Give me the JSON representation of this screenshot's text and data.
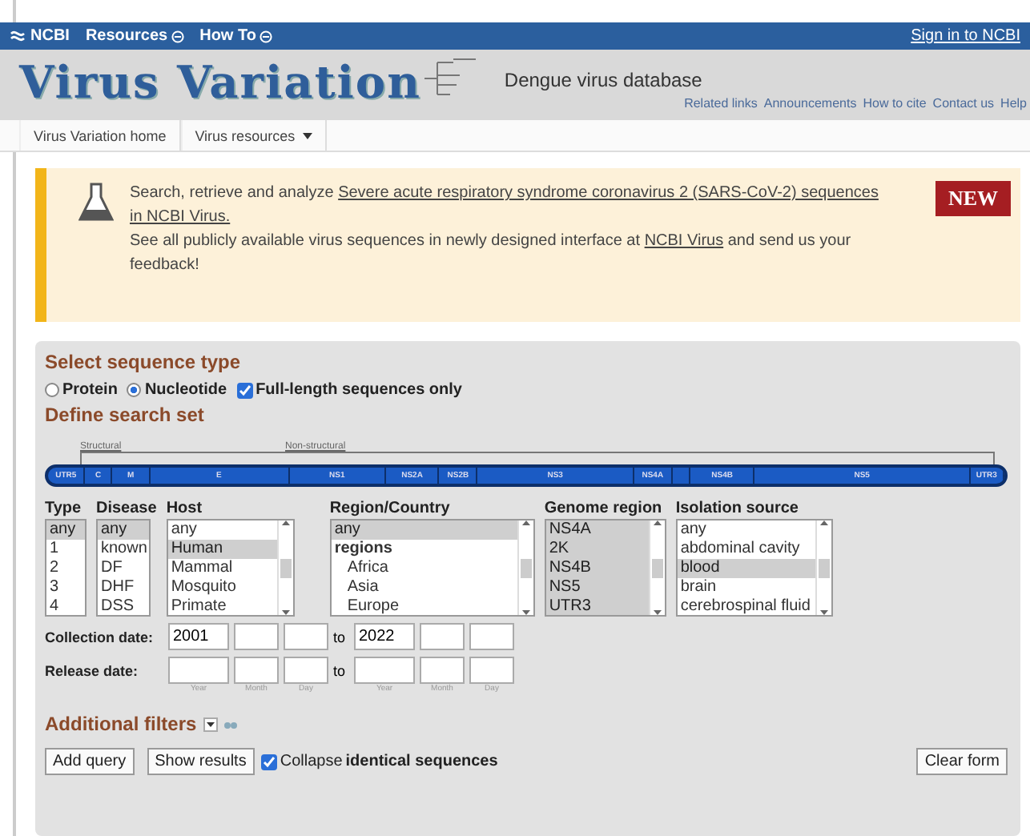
{
  "topbar": {
    "brand": "NCBI",
    "menus": [
      "Resources",
      "How To"
    ],
    "signin": "Sign in to NCBI"
  },
  "header": {
    "logo": "Virus Variation",
    "subtitle": "Dengue virus database",
    "links": [
      "Related links",
      "Announcements",
      "How to cite",
      "Contact us",
      "Help"
    ]
  },
  "nav": [
    {
      "label": "Virus Variation home",
      "dropdown": false
    },
    {
      "label": "Virus resources",
      "dropdown": true
    }
  ],
  "banner": {
    "line1": "Search, retrieve and analyze ",
    "link1": "Severe acute respiratory syndrome coronavirus 2 (SARS-CoV-2) sequences",
    "link1b": "in NCBI Virus.",
    "line2a": "See all publicly available virus sequences in newly designed interface at ",
    "link2": "NCBI Virus",
    "line2b": " and send us your feedback!",
    "badge": "NEW"
  },
  "form": {
    "title": "Select sequence type",
    "seqtype": [
      {
        "label": "Protein",
        "selected": false
      },
      {
        "label": "Nucleotide",
        "selected": true
      }
    ],
    "fulllength": {
      "label": "Full-length sequences only",
      "checked": true
    },
    "searchset": "Define search set",
    "brackets": [
      "Structural",
      "Non-structural"
    ],
    "segments": [
      {
        "kind": "named",
        "label": "UTR5"
      },
      {
        "kind": "named",
        "label": "C"
      },
      {
        "kind": "named",
        "label": "M"
      },
      {
        "kind": "named",
        "label": "E"
      },
      {
        "kind": "named",
        "label": "NS1"
      },
      {
        "kind": "named",
        "label": "NS2A"
      },
      {
        "kind": "named",
        "label": "NS2B"
      },
      {
        "kind": "named",
        "label": "NS3"
      },
      {
        "kind": "named",
        "label": "NS4A"
      },
      {
        "kind": "gap"
      },
      {
        "kind": "named",
        "label": "NS4B"
      },
      {
        "kind": "named",
        "label": "NS5"
      },
      {
        "kind": "named",
        "label": "UTR3"
      }
    ],
    "lists": [
      {
        "title": "Type",
        "scroll": false,
        "options": [
          {
            "label": "any",
            "selected": true
          },
          {
            "label": "1",
            "selected": false
          },
          {
            "label": "2",
            "selected": false
          },
          {
            "label": "3",
            "selected": false
          },
          {
            "label": "4",
            "selected": false
          }
        ]
      },
      {
        "title": "Disease",
        "scroll": false,
        "options": [
          {
            "label": "any",
            "selected": true
          },
          {
            "label": "known",
            "selected": false
          },
          {
            "label": "DF",
            "selected": false
          },
          {
            "label": "DHF",
            "selected": false
          },
          {
            "label": "DSS",
            "selected": false
          }
        ]
      },
      {
        "title": "Host",
        "scroll": true,
        "options": [
          {
            "label": "any",
            "selected": false
          },
          {
            "label": "Human",
            "selected": true
          },
          {
            "label": "Mammal",
            "selected": false
          },
          {
            "label": "Mosquito",
            "selected": false
          },
          {
            "label": "Primate",
            "selected": false
          }
        ]
      },
      {
        "title": "Region/Country",
        "scroll": true,
        "options": [
          {
            "label": "any",
            "selected": true
          },
          {
            "label": "regions",
            "selected": false,
            "children": [
              {
                "label": "Africa",
                "selected": false
              },
              {
                "label": "Asia",
                "selected": false
              },
              {
                "label": "Europe",
                "selected": false
              }
            ]
          }
        ]
      },
      {
        "title": "Genome region",
        "scroll": true,
        "options": [
          {
            "label": "NS4A",
            "selected": true
          },
          {
            "label": "2K",
            "selected": true
          },
          {
            "label": "NS4B",
            "selected": true
          },
          {
            "label": "NS5",
            "selected": true
          },
          {
            "label": "UTR3",
            "selected": true
          }
        ]
      },
      {
        "title": "Isolation source",
        "scroll": true,
        "options": [
          {
            "label": "any",
            "selected": false
          },
          {
            "label": "abdominal cavity",
            "selected": false
          },
          {
            "label": "blood",
            "selected": true
          },
          {
            "label": "brain",
            "selected": false
          },
          {
            "label": "cerebrospinal fluid",
            "selected": false
          }
        ]
      }
    ],
    "dates": [
      {
        "label": "Collection date:",
        "from": "2001",
        "to": "2022",
        "sep": "to"
      },
      {
        "label": "Release date:",
        "sep": "to",
        "hints": [
          "Year",
          "Month",
          "Day",
          "Year",
          "Month",
          "Day"
        ]
      }
    ],
    "additional": "Additional filters",
    "buttons": [
      "Add query",
      "Show results"
    ],
    "collapse": {
      "label": "Collapse ",
      "bold": "identical sequences",
      "checked": true
    },
    "clear": "Clear form"
  }
}
